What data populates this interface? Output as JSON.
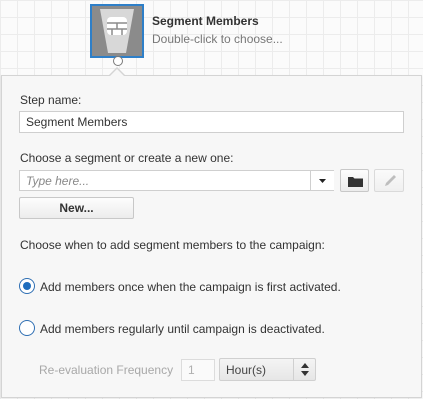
{
  "node": {
    "title": "Segment Members",
    "subtitle": "Double-click to choose..."
  },
  "form": {
    "step_name_label": "Step name:",
    "step_name_value": "Segment Members",
    "segment_label": "Choose a segment or create a new one:",
    "segment_placeholder": "Type here...",
    "new_button_label": "New...",
    "timing_label": "Choose when to add segment members to the campaign:",
    "option_once_label": "Add members once when the campaign is first activated.",
    "option_regular_label": "Add members regularly until campaign is deactivated.",
    "selected_option": "once",
    "frequency_label": "Re-evaluation Frequency",
    "frequency_value": "1",
    "frequency_unit": "Hour(s)"
  },
  "colors": {
    "accent": "#2e7fc8",
    "node_fill": "#8b8b8b"
  }
}
